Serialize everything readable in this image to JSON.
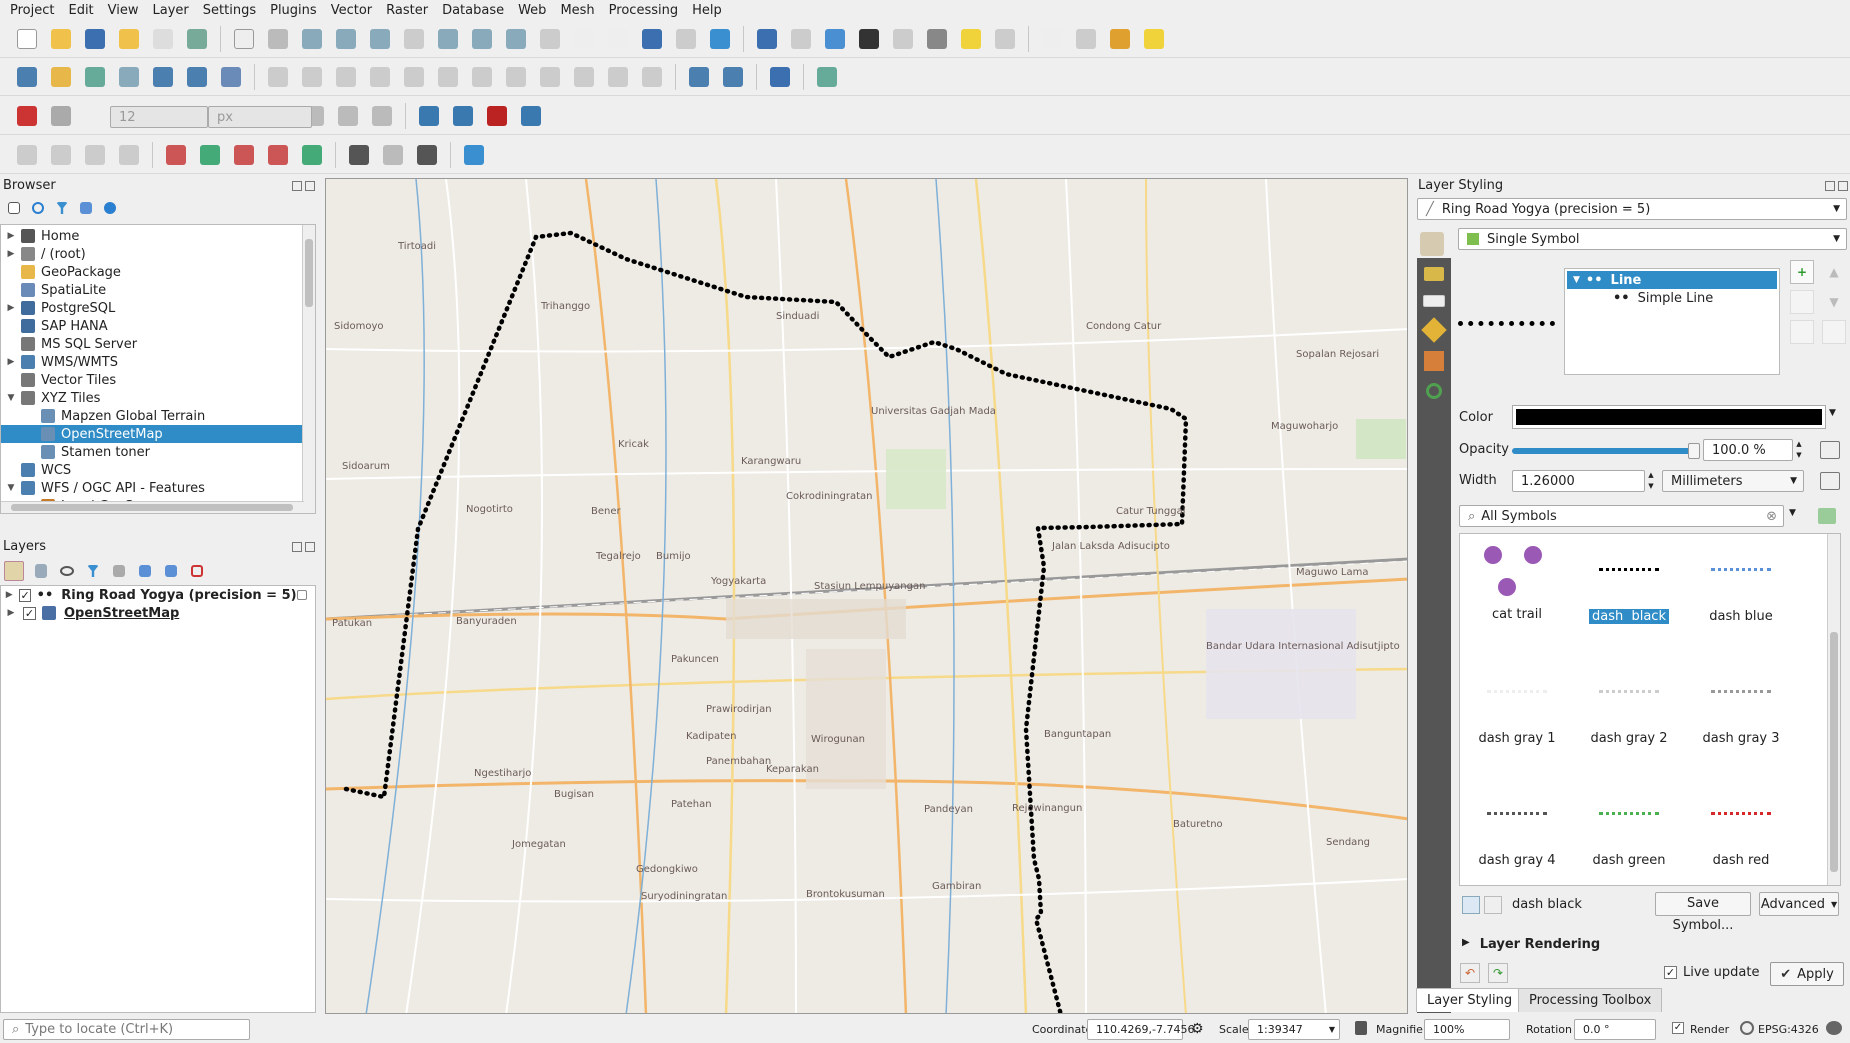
{
  "menu": [
    "Project",
    "Edit",
    "View",
    "Layer",
    "Settings",
    "Plugins",
    "Vector",
    "Raster",
    "Database",
    "Web",
    "Mesh",
    "Processing",
    "Help"
  ],
  "digitize": {
    "snap_value": "12",
    "snap_unit": "px"
  },
  "browser": {
    "title": "Browser",
    "items": [
      {
        "label": "Home",
        "expander": true,
        "depth": 0,
        "icon": "home-icon",
        "color": "#555"
      },
      {
        "label": "/ (root)",
        "expander": true,
        "depth": 0,
        "icon": "folder-icon",
        "color": "#888"
      },
      {
        "label": "GeoPackage",
        "expander": false,
        "depth": 0,
        "icon": "geopackage-icon",
        "color": "#e8b74a"
      },
      {
        "label": "SpatiaLite",
        "expander": false,
        "depth": 0,
        "icon": "spatialite-icon",
        "color": "#6a8ab8"
      },
      {
        "label": "PostgreSQL",
        "expander": true,
        "depth": 0,
        "icon": "postgresql-icon",
        "color": "#3f6c9c"
      },
      {
        "label": "SAP HANA",
        "expander": false,
        "depth": 0,
        "icon": "sap-hana-icon",
        "color": "#3f6c9c"
      },
      {
        "label": "MS SQL Server",
        "expander": false,
        "depth": 0,
        "icon": "mssql-icon",
        "color": "#777"
      },
      {
        "label": "WMS/WMTS",
        "expander": true,
        "depth": 0,
        "icon": "wms-icon",
        "color": "#4a7fb0"
      },
      {
        "label": "Vector Tiles",
        "expander": false,
        "depth": 0,
        "icon": "vector-tiles-icon",
        "color": "#777"
      },
      {
        "label": "XYZ Tiles",
        "expander": true,
        "depth": 0,
        "open": true,
        "icon": "xyz-tiles-icon",
        "color": "#777"
      },
      {
        "label": "Mapzen Global Terrain",
        "expander": false,
        "depth": 1,
        "icon": "tile-layer-icon",
        "color": "#6a8fb5"
      },
      {
        "label": "OpenStreetMap",
        "expander": false,
        "depth": 1,
        "icon": "tile-layer-icon",
        "color": "#6a8fb5",
        "selected": true
      },
      {
        "label": "Stamen toner",
        "expander": false,
        "depth": 1,
        "icon": "tile-layer-icon",
        "color": "#6a8fb5"
      },
      {
        "label": "WCS",
        "expander": false,
        "depth": 0,
        "icon": "wcs-icon",
        "color": "#4a7fb0"
      },
      {
        "label": "WFS / OGC API - Features",
        "expander": true,
        "depth": 0,
        "open": true,
        "icon": "wfs-icon",
        "color": "#4a7fb0"
      },
      {
        "label": "Local GeoServer",
        "expander": true,
        "depth": 1,
        "icon": "server-icon",
        "color": "#c67a2b"
      }
    ]
  },
  "layers": {
    "title": "Layers",
    "items": [
      {
        "label": "Ring Road Yogya (precision = 5)",
        "checked": true
      },
      {
        "label": "OpenStreetMap",
        "checked": true,
        "underline": true
      }
    ]
  },
  "map_labels": [
    {
      "text": "Tirtoadi"
    },
    {
      "text": "Sidomoyo"
    },
    {
      "text": "Trihanggo"
    },
    {
      "text": "Sinduadi"
    },
    {
      "text": "Condong Catur"
    },
    {
      "text": "Universitas Gadjah Mada"
    },
    {
      "text": "Kricak"
    },
    {
      "text": "Karangwaru"
    },
    {
      "text": "Cokrodiningratan"
    },
    {
      "text": "Sidoarum"
    },
    {
      "text": "Nogotirto"
    },
    {
      "text": "Bener"
    },
    {
      "text": "Catur Tunggal"
    },
    {
      "text": "Maguwoharjo"
    },
    {
      "text": "Bumijo"
    },
    {
      "text": "Tegalrejo"
    },
    {
      "text": "Yogyakarta"
    },
    {
      "text": "Stasiun Lempuyangan"
    },
    {
      "text": "Banyuraden"
    },
    {
      "text": "Patukan"
    },
    {
      "text": "Pakuncen"
    },
    {
      "text": "Prawirodirjan"
    },
    {
      "text": "Kadipaten"
    },
    {
      "text": "Wirogunan"
    },
    {
      "text": "Panembahan"
    },
    {
      "text": "Keparakan"
    },
    {
      "text": "Ngestiharjo"
    },
    {
      "text": "Bugisan"
    },
    {
      "text": "Patehan"
    },
    {
      "text": "Pandeyan"
    },
    {
      "text": "Banguntapan"
    },
    {
      "text": "Rejowinangun"
    },
    {
      "text": "Jomegatan"
    },
    {
      "text": "Gedongkiwo"
    },
    {
      "text": "Suryodiningratan"
    },
    {
      "text": "Brontokusuman"
    },
    {
      "text": "Baturetno"
    },
    {
      "text": "Sendang"
    },
    {
      "text": "Gambiran"
    },
    {
      "text": "Sopalan Rejosari"
    },
    {
      "text": "Bandar Udara Internasional Adisutjipto"
    },
    {
      "text": "Maguwo Lama"
    },
    {
      "text": "Jalan Laksda Adisucipto"
    }
  ],
  "styling": {
    "title": "Layer Styling",
    "layer_select": "Ring Road Yogya (precision = 5)",
    "renderer": "Single Symbol",
    "tree": {
      "root": "Line",
      "child": "Simple Line"
    },
    "color_label": "Color",
    "color": "#000000",
    "opacity_label": "Opacity",
    "opacity": "100.0 %",
    "opacity_fraction": 1.0,
    "width_label": "Width",
    "width": "1.26000",
    "width_unit": "Millimeters",
    "search_placeholder": "All Symbols",
    "symbols": [
      {
        "name": "cat trail",
        "kind": "cat",
        "color": "#9b59b6"
      },
      {
        "name": "dash  black",
        "kind": "dash",
        "color": "#000000",
        "selected": true
      },
      {
        "name": "dash blue",
        "kind": "dash",
        "color": "#5b8fd6"
      },
      {
        "name": "dash gray 1",
        "kind": "dash",
        "color": "#eeeeee"
      },
      {
        "name": "dash gray 2",
        "kind": "dash",
        "color": "#cccccc"
      },
      {
        "name": "dash gray 3",
        "kind": "dash",
        "color": "#999999"
      },
      {
        "name": "dash gray 4",
        "kind": "dash",
        "color": "#555555"
      },
      {
        "name": "dash green",
        "kind": "dash",
        "color": "#4caf50"
      },
      {
        "name": "dash red",
        "kind": "dash",
        "color": "#d62828"
      }
    ],
    "selected_symbol": "dash  black",
    "save_symbol": "Save Symbol...",
    "advanced": "Advanced",
    "layer_rendering": "Layer Rendering",
    "live_update": "Live update",
    "apply": "Apply",
    "tabs": [
      "Layer Styling",
      "Processing Toolbox"
    ]
  },
  "status": {
    "locate_placeholder": "Type to locate (Ctrl+K)",
    "coordinate_label": "Coordinate",
    "coordinate": "110.4269,-7.7456",
    "scale_label": "Scale",
    "scale": "1:39347",
    "magnifier_label": "Magnifier",
    "magnifier": "100%",
    "rotation_label": "Rotation",
    "rotation": "0.0 °",
    "render_label": "Render",
    "crs": "EPSG:4326"
  }
}
